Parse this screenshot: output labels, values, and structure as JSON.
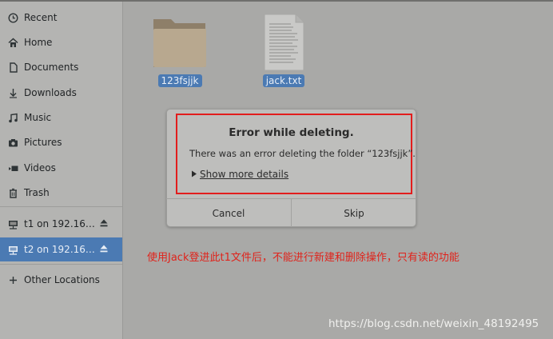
{
  "sidebar": {
    "items": [
      {
        "label": "Recent",
        "icon": "clock-icon"
      },
      {
        "label": "Home",
        "icon": "home-icon"
      },
      {
        "label": "Documents",
        "icon": "document-icon"
      },
      {
        "label": "Downloads",
        "icon": "download-icon"
      },
      {
        "label": "Music",
        "icon": "music-icon"
      },
      {
        "label": "Pictures",
        "icon": "camera-icon"
      },
      {
        "label": "Videos",
        "icon": "video-icon"
      },
      {
        "label": "Trash",
        "icon": "trash-icon"
      }
    ],
    "mounts": [
      {
        "label": "t1 on 192.16…",
        "icon": "network-drive-icon",
        "selected": false
      },
      {
        "label": "t2 on 192.16…",
        "icon": "network-drive-icon",
        "selected": true
      }
    ],
    "other_locations": "Other Locations"
  },
  "files": [
    {
      "name": "123fsjjk",
      "icon": "folder-icon"
    },
    {
      "name": "jack.txt",
      "icon": "text-file-icon"
    }
  ],
  "dialog": {
    "title": "Error while deleting.",
    "message": "There was an error deleting the folder “123fsjjk”.",
    "details_label": "Show more details",
    "cancel_label": "Cancel",
    "skip_label": "Skip"
  },
  "annotation": "使用Jack登进此t1文件后，不能进行新建和删除操作，只有读的功能",
  "watermark": "https://blog.csdn.net/weixin_48192495",
  "colors": {
    "selection": "#4b7ab3",
    "annotation_red": "#e0231b",
    "background": "#a9a9a7"
  }
}
